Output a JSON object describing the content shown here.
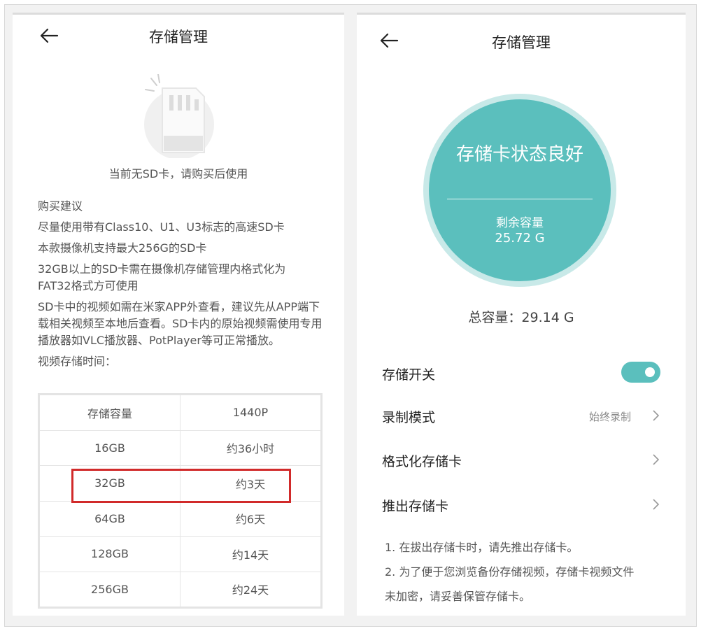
{
  "left_screen": {
    "title": "存储管理",
    "no_card_text": "当前无SD卡，请购买后使用",
    "advice": [
      "购买建议",
      "尽量使用带有Class10、U1、U3标志的高速SD卡",
      "本款摄像机支持最大256G的SD卡",
      "32GB以上的SD卡需在摄像机存储管理内格式化为FAT32格式方可使用",
      "SD卡中的视频如需在米家APP外查看，建议先从APP端下载相关视频至本地后查看。SD卡内的原始视频需使用专用播放器如VLC播放器、PotPlayer等可正常播放。",
      "视频存储时间："
    ],
    "table": {
      "headers": [
        "存储容量",
        "1440P"
      ],
      "rows": [
        [
          "16GB",
          "约36小时"
        ],
        [
          "32GB",
          "约3天"
        ],
        [
          "64GB",
          "约6天"
        ],
        [
          "128GB",
          "约14天"
        ],
        [
          "256GB",
          "约24天"
        ]
      ]
    },
    "highlight_color": "#d12a2a"
  },
  "right_screen": {
    "title": "存储管理",
    "status": "存储卡状态良好",
    "remaining_label": "剩余容量",
    "remaining_value": "25.72 G",
    "total_capacity": "总容量：29.14 G",
    "settings": {
      "storage_switch": {
        "label": "存储开关",
        "on": true
      },
      "record_mode": {
        "label": "录制模式",
        "value": "始终录制"
      },
      "format_card": {
        "label": "格式化存储卡"
      },
      "eject_card": {
        "label": "推出存储卡"
      }
    },
    "notes": [
      "1. 在拔出存储卡时，请先推出存储卡。",
      "2. 为了便于您浏览备份存储视频，存储卡视频文件",
      "未加密，请妥善保管存储卡。"
    ],
    "accent_color": "#5bbfbd"
  }
}
